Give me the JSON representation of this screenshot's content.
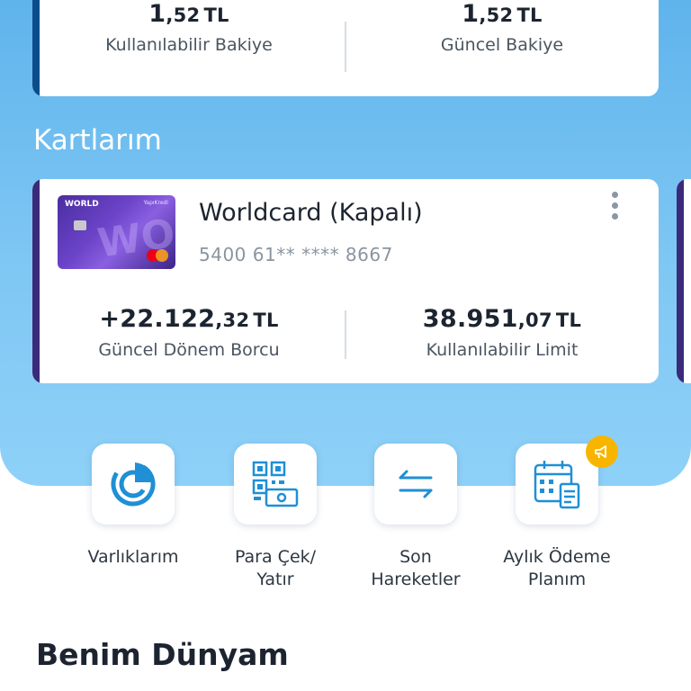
{
  "account": {
    "available": {
      "int": "1",
      "dec": ",52",
      "cur": "TL",
      "label": "Kullanılabilir Bakiye"
    },
    "current": {
      "int": "1",
      "dec": ",52",
      "cur": "TL",
      "label": "Güncel Bakiye"
    }
  },
  "cards_section": {
    "title": "Kartlarım"
  },
  "card": {
    "name": "Worldcard (Kapalı)",
    "number": "5400 61** **** 8667",
    "image": {
      "brand_text": "WORLD",
      "bank_text": "YapıKredi",
      "watermark": "WORLD"
    },
    "period_debt": {
      "int": "+22.122",
      "dec": ",32",
      "cur": "TL",
      "label": "Güncel Dönem Borcu"
    },
    "available_limit": {
      "int": "38.951",
      "dec": ",07",
      "cur": "TL",
      "label": "Kullanılabilir Limit"
    }
  },
  "actions": [
    {
      "label": "Varlıklarım",
      "icon": "assets-pie-icon"
    },
    {
      "label": "Para Çek/\nYatır",
      "icon": "qr-cash-icon"
    },
    {
      "label": "Son\nHareketler",
      "icon": "transfer-arrows-icon"
    },
    {
      "label": "Aylık Ödeme\nPlanım",
      "icon": "calendar-plan-icon"
    }
  ],
  "colors": {
    "accent": "#1f8fd6",
    "header_bg": "#5fb4ec",
    "badge": "#f7b500",
    "card_stripe": "#3b2a7a",
    "account_stripe": "#0b4d8c"
  },
  "world_section": {
    "title": "Benim Dünyam"
  }
}
